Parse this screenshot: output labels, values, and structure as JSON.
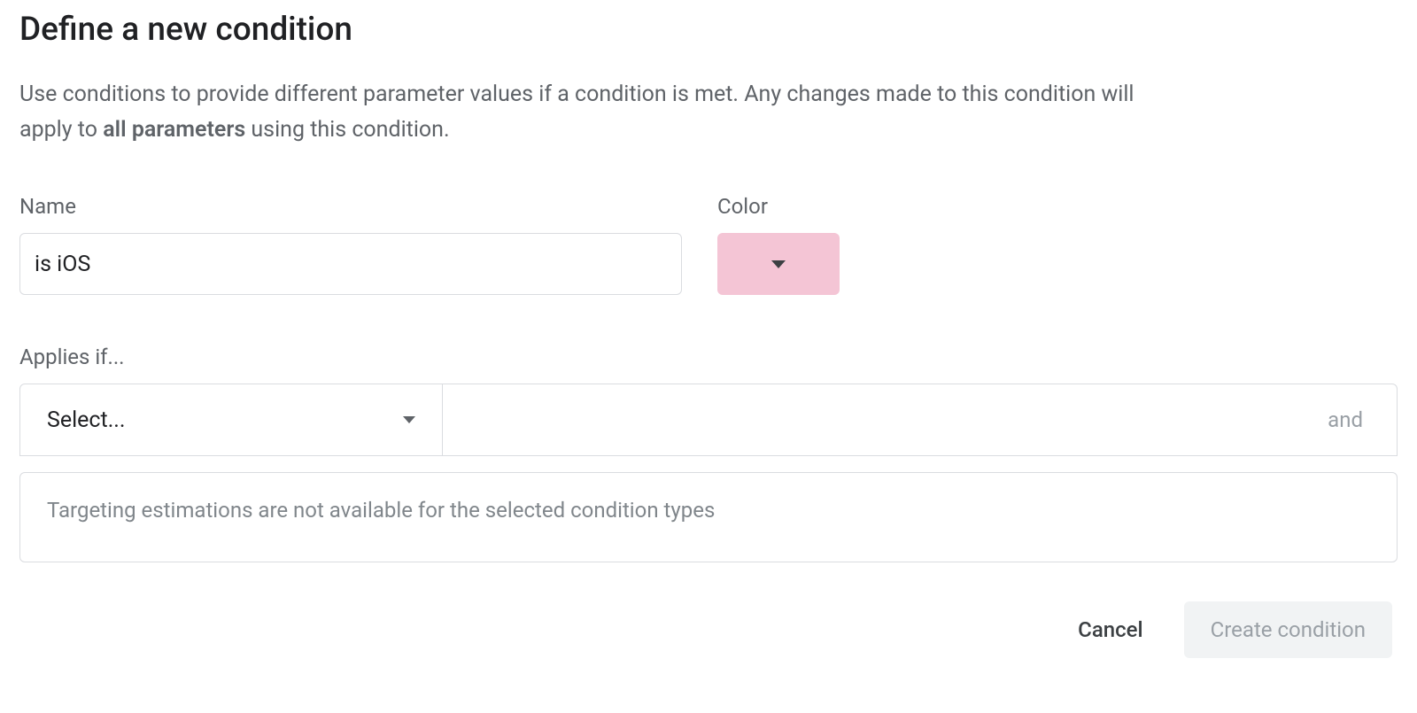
{
  "title": "Define a new condition",
  "description": {
    "prefix": "Use conditions to provide different parameter values if a condition is met. Any changes made to this condition will apply to ",
    "bold": "all parameters",
    "suffix": " using this condition."
  },
  "form": {
    "name_label": "Name",
    "name_value": "is iOS",
    "color_label": "Color",
    "color_value": "#f4c5d5"
  },
  "applies": {
    "label": "Applies if...",
    "select_placeholder": "Select...",
    "and_label": "and"
  },
  "estimation": {
    "message": "Targeting estimations are not available for the selected condition types"
  },
  "buttons": {
    "cancel": "Cancel",
    "create": "Create condition"
  }
}
